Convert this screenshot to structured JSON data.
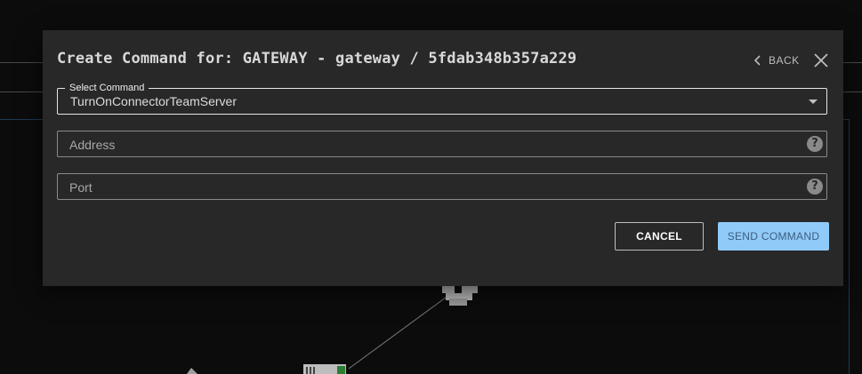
{
  "dialog": {
    "title": "Create Command for: GATEWAY - gateway / 5fdab348b357a229",
    "back_label": "BACK",
    "icons": {
      "back": "chevron-left-icon",
      "close": "close-icon",
      "help": "help-circle-icon",
      "dropdown": "caret-down-icon"
    }
  },
  "form": {
    "select_command": {
      "label": "Select Command",
      "value": "TurnOnConnectorTeamServer"
    },
    "address": {
      "placeholder": "Address"
    },
    "port": {
      "placeholder": "Port"
    }
  },
  "actions": {
    "cancel_label": "CANCEL",
    "send_label": "SEND COMMAND"
  },
  "colors": {
    "dialog_bg": "#282828",
    "page_bg": "#0c0c0c",
    "primary_button": "#90caf9"
  }
}
